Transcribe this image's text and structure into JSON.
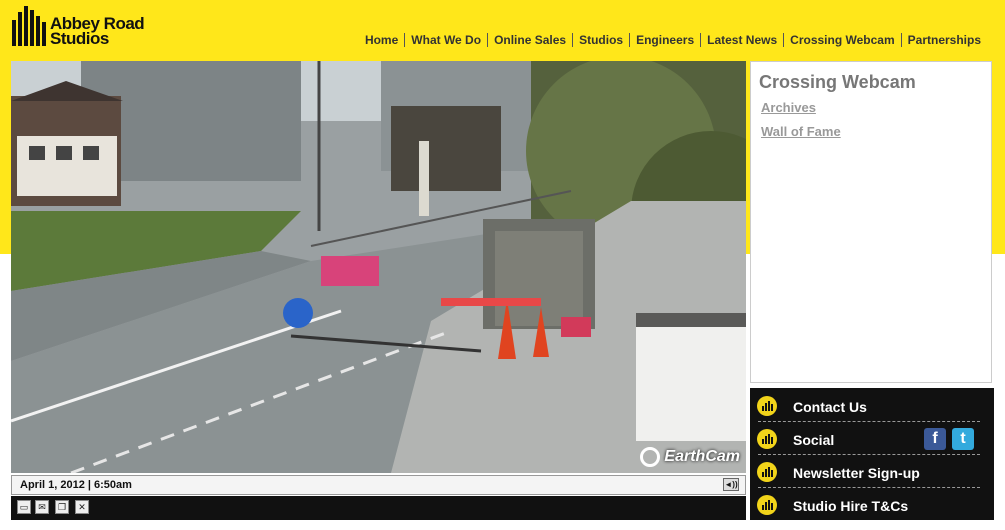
{
  "brand": {
    "line1": "Abbey Road",
    "line2": "Studios"
  },
  "nav": [
    "Home",
    "What We Do",
    "Online Sales",
    "Studios",
    "Engineers",
    "Latest News",
    "Crossing Webcam",
    "Partnerships"
  ],
  "webcam": {
    "watermark": "EarthCam",
    "timestamp": "April 1, 2012 | 6:50am"
  },
  "side": {
    "title": "Crossing Webcam",
    "links": [
      "Archives",
      "Wall of Fame"
    ]
  },
  "links": [
    "Contact Us",
    "Social",
    "Newsletter Sign-up",
    "Studio Hire T&Cs"
  ],
  "social": {
    "facebook": "f",
    "twitter": "t"
  },
  "colors": {
    "brand_yellow": "#ffe71a",
    "dark": "#111111",
    "bullet": "#f2d41a",
    "facebook": "#3b5998",
    "twitter": "#33aadd"
  },
  "icons": [
    "earthcam-logo-icon",
    "volume-icon",
    "snapshot-icon",
    "email-icon",
    "bookmark-icon",
    "fullscreen-icon",
    "abbey-road-bars-icon",
    "facebook-icon",
    "twitter-icon"
  ]
}
